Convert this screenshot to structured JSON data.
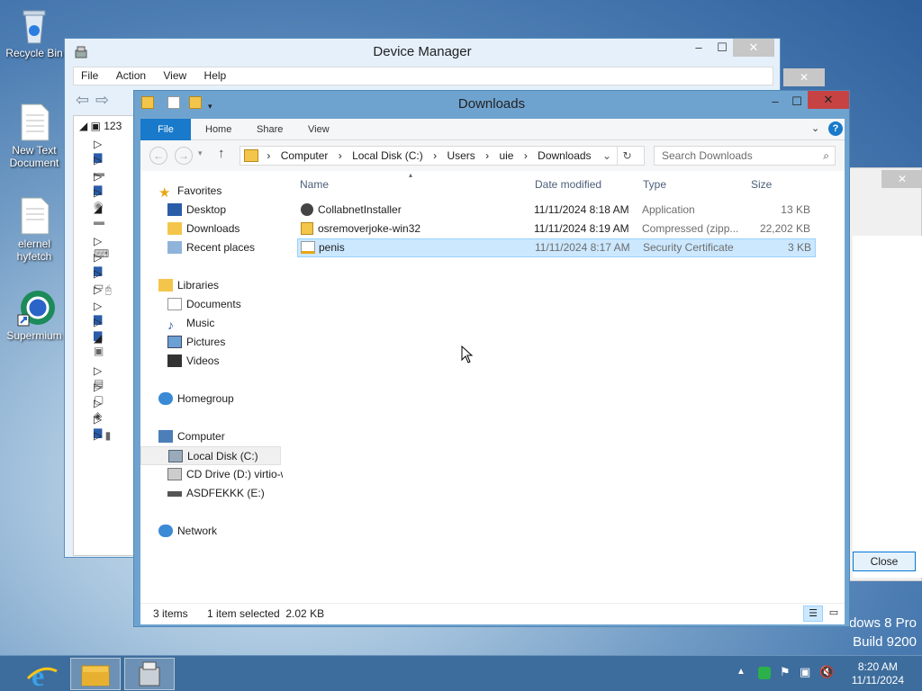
{
  "desktop": {
    "icons": [
      {
        "label": "Recycle Bin"
      },
      {
        "label": "New Text Document"
      },
      {
        "label": "elernel hyfetch"
      },
      {
        "label": "Supermium"
      }
    ],
    "watermark": {
      "line1": "dows 8 Pro",
      "line2": "Build 9200"
    }
  },
  "device_manager": {
    "title": "Device Manager",
    "menu": [
      "File",
      "Action",
      "View",
      "Help"
    ],
    "tree_root": "123"
  },
  "background_dialog": {
    "close_label": "Close"
  },
  "explorer": {
    "title": "Downloads",
    "ribbon_tabs": [
      "File",
      "Home",
      "Share",
      "View"
    ],
    "address": [
      "Computer",
      "Local Disk (C:)",
      "Users",
      "uie",
      "Downloads"
    ],
    "search_placeholder": "Search Downloads",
    "nav": {
      "favorites": "Favorites",
      "desktop": "Desktop",
      "downloads": "Downloads",
      "recent": "Recent places",
      "libraries": "Libraries",
      "documents": "Documents",
      "music": "Music",
      "pictures": "Pictures",
      "videos": "Videos",
      "homegroup": "Homegroup",
      "computer": "Computer",
      "local_disk": "Local Disk (C:)",
      "cd_drive": "CD Drive (D:) virtio-w",
      "asdf": "ASDFEKKK (E:)",
      "network": "Network"
    },
    "columns": {
      "name": "Name",
      "date": "Date modified",
      "type": "Type",
      "size": "Size"
    },
    "files": [
      {
        "name": "CollabnetInstaller",
        "date": "11/11/2024 8:18 AM",
        "type": "Application",
        "size": "13 KB",
        "selected": false
      },
      {
        "name": "osremoverjoke-win32",
        "date": "11/11/2024 8:19 AM",
        "type": "Compressed (zipp...",
        "size": "22,202 KB",
        "selected": false
      },
      {
        "name": "penis",
        "date": "11/11/2024 8:17 AM",
        "type": "Security Certificate",
        "size": "3 KB",
        "selected": true
      }
    ],
    "status": {
      "items": "3 items",
      "selection": "1 item selected  2.02 KB"
    }
  },
  "taskbar": {
    "time": "8:20 AM",
    "date": "11/11/2024"
  }
}
